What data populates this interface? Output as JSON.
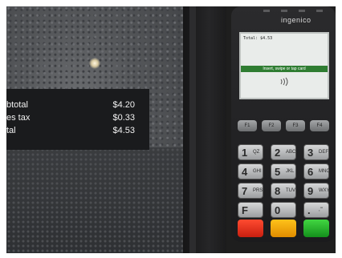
{
  "display": {
    "lines": [
      {
        "label": "btotal",
        "value": "$4.20"
      },
      {
        "label": "es tax",
        "value": "$0.33"
      },
      {
        "label": "tal",
        "value": "$4.53"
      }
    ]
  },
  "terminal": {
    "brand": "ingenico",
    "screen_total": "Total: $4.53",
    "screen_prompt": "Insert, swipe or tap card",
    "fkeys": [
      "F1",
      "F2",
      "F3",
      "F4"
    ],
    "keys": [
      {
        "digit": "1",
        "sub": "QZ"
      },
      {
        "digit": "2",
        "sub": "ABC"
      },
      {
        "digit": "3",
        "sub": "DEF"
      },
      {
        "digit": "4",
        "sub": "GHI"
      },
      {
        "digit": "5",
        "sub": "JKL"
      },
      {
        "digit": "6",
        "sub": "MNO"
      },
      {
        "digit": "7",
        "sub": "PRS"
      },
      {
        "digit": "8",
        "sub": "TUV"
      },
      {
        "digit": "9",
        "sub": "WXY"
      },
      {
        "digit": "F",
        "sub": ""
      },
      {
        "digit": "0",
        "sub": ""
      },
      {
        "digit": ".",
        "sub": ",'\""
      }
    ],
    "action_key_colors": {
      "cancel": "#e8321e",
      "clear": "#f2a600",
      "enter": "#2bb52e"
    }
  }
}
